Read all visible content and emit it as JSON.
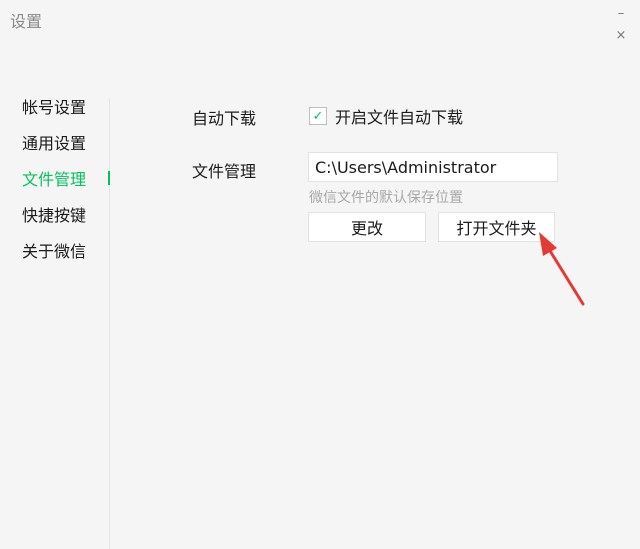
{
  "window": {
    "title": "设置",
    "controls": {
      "minimize": "–",
      "close": "×"
    }
  },
  "sidebar": {
    "items": [
      {
        "label": "帐号设置",
        "active": false
      },
      {
        "label": "通用设置",
        "active": false
      },
      {
        "label": "文件管理",
        "active": true
      },
      {
        "label": "快捷按键",
        "active": false
      },
      {
        "label": "关于微信",
        "active": false
      }
    ]
  },
  "main": {
    "auto_download": {
      "label": "自动下载",
      "checkbox_label": "开启文件自动下载",
      "checked": true,
      "check_glyph": "✓"
    },
    "file_management": {
      "label": "文件管理",
      "path_value": "C:\\Users\\Administrator",
      "hint": "微信文件的默认保存位置",
      "change_button": "更改",
      "open_folder_button": "打开文件夹"
    }
  },
  "colors": {
    "accent": "#07c160",
    "annotation_arrow": "#e53935"
  },
  "icons": {
    "checkbox": "check-icon",
    "annotation": "red-arrow-pointer"
  }
}
